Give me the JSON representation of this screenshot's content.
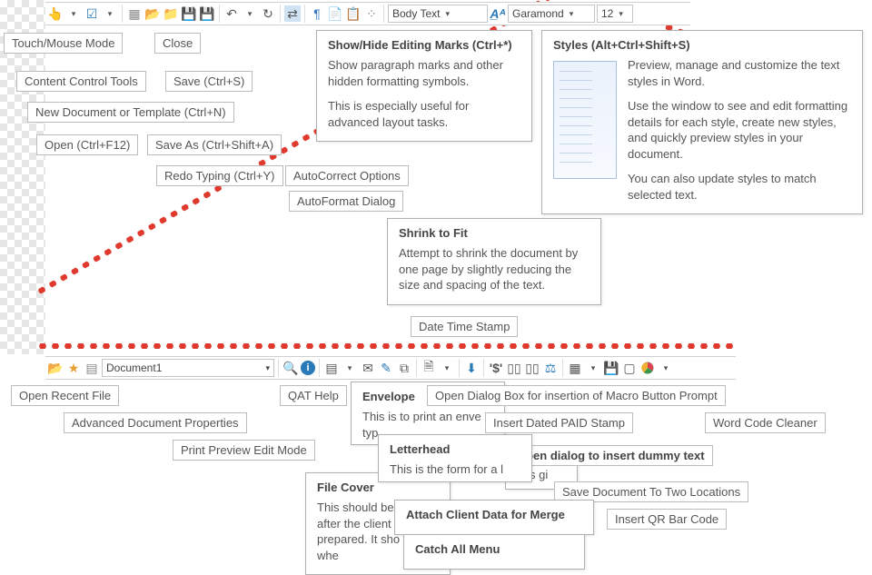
{
  "toolbar1": {
    "style_dropdown": "Body Text",
    "font_dropdown": "Garamond",
    "size_dropdown": "12"
  },
  "toolbar2": {
    "doc_dropdown": "Document1"
  },
  "callouts": {
    "touch_mouse": "Touch/Mouse Mode",
    "close": "Close",
    "content_control": "Content Control Tools",
    "save": "Save (Ctrl+S)",
    "new_doc": "New Document or Template (Ctrl+N)",
    "open": "Open (Ctrl+F12)",
    "save_as": "Save As (Ctrl+Shift+A)",
    "redo": "Redo Typing (Ctrl+Y)",
    "autocorrect": "AutoCorrect Options",
    "autoformat": "AutoFormat Dialog",
    "date_time": "Date  Time Stamp",
    "open_recent": "Open Recent File",
    "adv_doc_props": "Advanced Document Properties",
    "print_preview": "Print Preview Edit Mode",
    "qat_help": "QAT Help",
    "macro_button": "Open Dialog Box for insertion of Macro Button Prompt",
    "paid_stamp": "Insert Dated PAID Stamp",
    "word_cleaner": "Word Code Cleaner",
    "dummy_text": "Open dialog to insert dummy text",
    "save_two": "Save Document To Two Locations",
    "qr_code": "Insert QR Bar Code"
  },
  "tooltips": {
    "editing_marks": {
      "title": "Show/Hide Editing Marks (Ctrl+*)",
      "p1": "Show paragraph marks and other hidden formatting symbols.",
      "p2": "This is especially useful for advanced layout tasks."
    },
    "styles": {
      "title": "Styles (Alt+Ctrl+Shift+S)",
      "p1": "Preview, manage and customize the text styles in Word.",
      "p2": "Use the window to see and edit formatting details for each style, create new styles, and quickly preview styles in your document.",
      "p3": "You can also update styles to match selected text."
    },
    "shrink": {
      "title": "Shrink to Fit",
      "p1": "Attempt to shrink the document by one page by slightly reducing the size and spacing of the text."
    },
    "envelope": {
      "title": "Envelope",
      "p1": "This is to print an enve",
      "p2": "typ"
    },
    "letterhead": {
      "title": "Letterhead",
      "p1": "This is the form for a l"
    },
    "filecover": {
      "title": "File Cover",
      "p1": "This should be",
      "p2": "after the client",
      "p3": "prepared. It    sho",
      "p4": "whe"
    },
    "dummy2": {
      "p1": "This gi"
    },
    "attach": {
      "title": "Attach Client Data for Merge"
    },
    "catchall": {
      "title": "Catch All Menu"
    }
  }
}
